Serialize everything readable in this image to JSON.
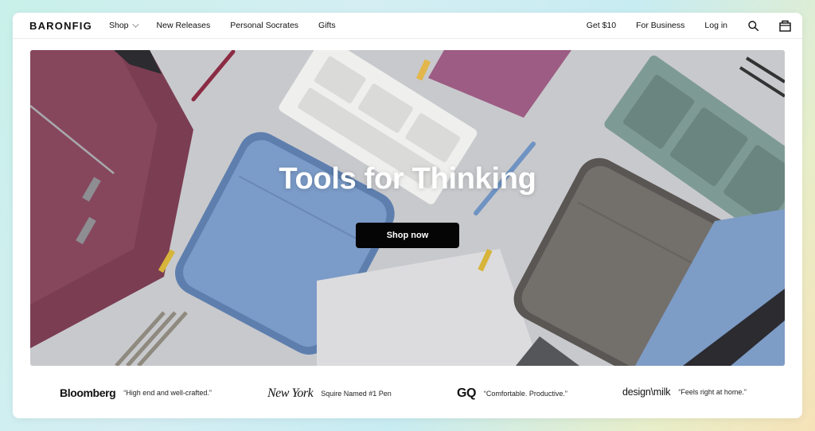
{
  "header": {
    "logo": "BARONFIG",
    "nav_left": [
      {
        "label": "Shop",
        "has_dropdown": true
      },
      {
        "label": "New Releases"
      },
      {
        "label": "Personal Socrates"
      },
      {
        "label": "Gifts"
      }
    ],
    "nav_right": [
      {
        "label": "Get $10"
      },
      {
        "label": "For Business"
      },
      {
        "label": "Log in"
      }
    ],
    "icons": [
      "search-icon",
      "bag-icon"
    ]
  },
  "hero": {
    "title": "Tools for Thinking",
    "button_label": "Shop now"
  },
  "press": [
    {
      "logo": "Bloomberg",
      "quote": "“High end and well-crafted.”"
    },
    {
      "logo": "New York",
      "quote": "Squire Named #1 Pen"
    },
    {
      "logo": "GQ",
      "quote": "“Comfortable. Productive.”"
    },
    {
      "logo": "design\\milk",
      "quote": "“Feels right at home.”"
    }
  ],
  "colors": {
    "button_bg": "#050505",
    "text": "#111111",
    "page_bg_gradient": [
      "#c9f0ea",
      "#f6e2b8"
    ]
  }
}
